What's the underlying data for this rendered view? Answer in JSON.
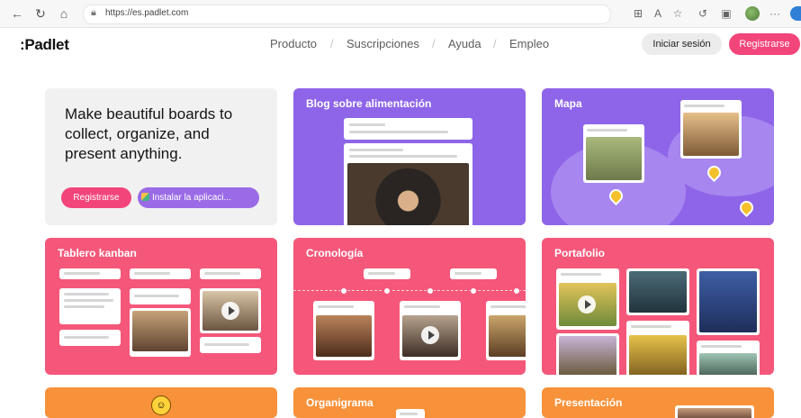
{
  "browser": {
    "url": "https://es.padlet.com",
    "nav_icons": [
      "back-icon",
      "refresh-icon",
      "home-icon"
    ],
    "right_icons": [
      "grid-icon",
      "read-aloud-icon",
      "favorites-icon",
      "reload-extension-icon",
      "collections-icon",
      "profile-icon",
      "more-icon"
    ]
  },
  "header": {
    "logo": ":Padlet",
    "nav": [
      "Producto",
      "Suscripciones",
      "Ayuda",
      "Empleo"
    ],
    "nav_separator": "/",
    "login_label": "Iniciar sesión",
    "register_label": "Registrarse"
  },
  "hero": {
    "heading": "Make beautiful boards to collect, organize, and present anything.",
    "register_label": "Registrarse",
    "install_label": "Instalar la aplicaci..."
  },
  "cards": [
    {
      "title": "Blog sobre alimentación",
      "color": "#8e65e8"
    },
    {
      "title": "Mapa",
      "color": "#8e65e8"
    },
    {
      "title": "Tablero kanban",
      "color": "#f4577a"
    },
    {
      "title": "Cronología",
      "color": "#f4577a"
    },
    {
      "title": "Portafolio",
      "color": "#f4577a"
    },
    {
      "title": "",
      "color": "#f7923a"
    },
    {
      "title": "Organigrama",
      "color": "#f7923a"
    },
    {
      "title": "Presentación",
      "color": "#f7923a"
    }
  ],
  "colors": {
    "brand_pink": "#f2457a",
    "purple": "#9a6be6",
    "hero_bg": "#f1f1f2"
  }
}
